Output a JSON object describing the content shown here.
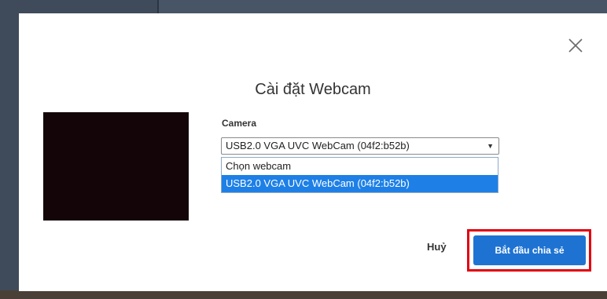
{
  "dialog": {
    "title": "Cài đặt Webcam",
    "close_icon": "close-icon"
  },
  "camera": {
    "label": "Camera",
    "selected_value": "USB2.0 VGA UVC WebCam (04f2:b52b)",
    "options": [
      {
        "label": "Chọn webcam",
        "selected": false
      },
      {
        "label": "USB2.0 VGA UVC WebCam (04f2:b52b)",
        "selected": true
      }
    ]
  },
  "footer": {
    "cancel_label": "Huỷ",
    "start_label": "Bắt đầu chia sẻ",
    "highlight_color": "#e3000f",
    "primary_color": "#1e73d2"
  }
}
